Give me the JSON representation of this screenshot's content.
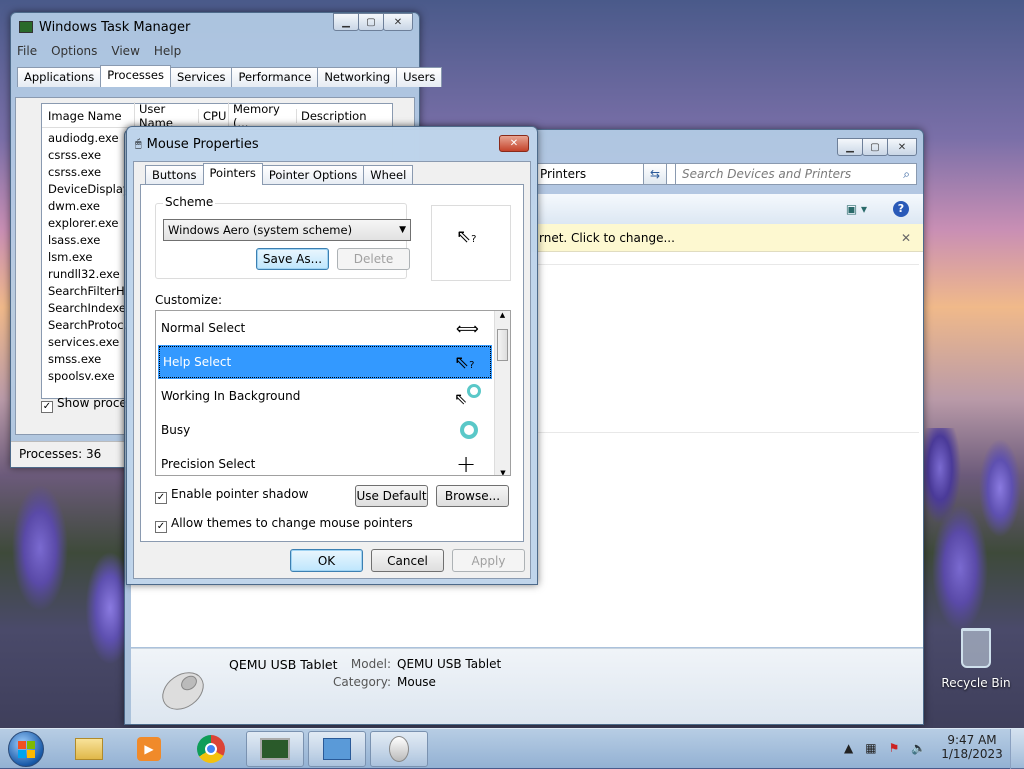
{
  "taskmgr": {
    "title": "Windows Task Manager",
    "menu": [
      "File",
      "Options",
      "View",
      "Help"
    ],
    "tabs": [
      "Applications",
      "Processes",
      "Services",
      "Performance",
      "Networking",
      "Users"
    ],
    "columns": [
      "Image Name",
      "User Name",
      "CPU",
      "Memory (...",
      "Description"
    ],
    "processes": [
      "audiodg.exe",
      "csrss.exe",
      "csrss.exe",
      "DeviceDisplay...",
      "dwm.exe",
      "explorer.exe",
      "lsass.exe",
      "lsm.exe",
      "rundll32.exe",
      "SearchFilterH...",
      "SearchIndexe...",
      "SearchProtoc...",
      "services.exe",
      "smss.exe",
      "spoolsv.exe"
    ],
    "show_processes": "Show processe",
    "status": "Processes: 36"
  },
  "devices": {
    "breadcrumb": "Printers",
    "search_placeholder": "Search Devices and Printers",
    "notice": "rnet. Click to change...",
    "device_name": "QEMU USB Tablet",
    "model_label": "Model:",
    "model_value": "QEMU USB Tablet",
    "category_label": "Category:",
    "category_value": "Mouse"
  },
  "mouse": {
    "title": "Mouse Properties",
    "tabs": [
      "Buttons",
      "Pointers",
      "Pointer Options",
      "Wheel"
    ],
    "scheme_label": "Scheme",
    "scheme_value": "Windows Aero (system scheme)",
    "save_as": "Save As...",
    "delete": "Delete",
    "customize_label": "Customize:",
    "pointers": [
      "Normal Select",
      "Help Select",
      "Working In Background",
      "Busy",
      "Precision Select"
    ],
    "selected_index": 1,
    "enable_shadow": "Enable pointer shadow",
    "allow_themes": "Allow themes to change mouse pointers",
    "use_default": "Use Default",
    "browse": "Browse...",
    "ok": "OK",
    "cancel": "Cancel",
    "apply": "Apply"
  },
  "desktop": {
    "recycle_bin": "Recycle Bin"
  },
  "clock": {
    "time": "9:47 AM",
    "date": "1/18/2023"
  },
  "colors": {
    "selection": "#3399ff",
    "notice_bg": "#fdf8d0"
  }
}
